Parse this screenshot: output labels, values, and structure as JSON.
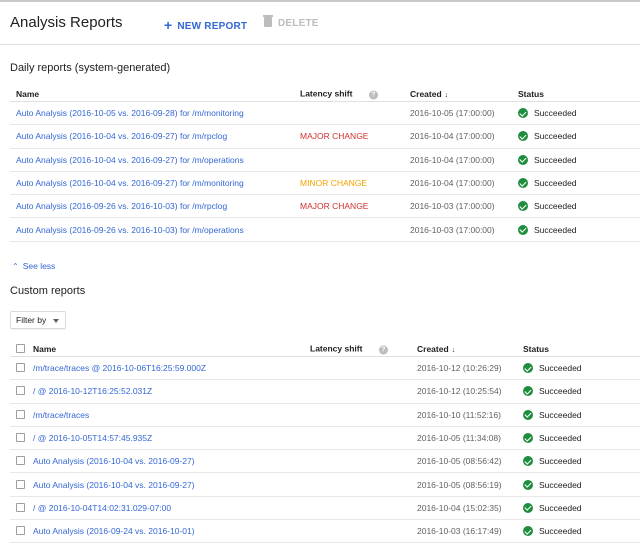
{
  "header": {
    "title": "Analysis Reports",
    "new_report_label": "NEW REPORT",
    "delete_label": "DELETE"
  },
  "daily": {
    "section_title": "Daily reports (system-generated)",
    "columns": {
      "name": "Name",
      "latency": "Latency shift",
      "created": "Created",
      "status": "Status"
    },
    "rows": [
      {
        "name": "Auto Analysis (2016-10-05 vs. 2016-09-28) for /m/monitoring",
        "shift": "",
        "shift_level": "",
        "created": "2016-10-05 (17:00:00)",
        "status": "Succeeded"
      },
      {
        "name": "Auto Analysis (2016-10-04 vs. 2016-09-27) for /m/rpclog",
        "shift": "MAJOR CHANGE",
        "shift_level": "major",
        "created": "2016-10-04 (17:00:00)",
        "status": "Succeeded"
      },
      {
        "name": "Auto Analysis (2016-10-04 vs. 2016-09-27) for /m/operations",
        "shift": "",
        "shift_level": "",
        "created": "2016-10-04 (17:00:00)",
        "status": "Succeeded"
      },
      {
        "name": "Auto Analysis (2016-10-04 vs. 2016-09-27) for /m/monitoring",
        "shift": "MINOR CHANGE",
        "shift_level": "minor",
        "created": "2016-10-04 (17:00:00)",
        "status": "Succeeded"
      },
      {
        "name": "Auto Analysis (2016-09-26 vs. 2016-10-03) for /m/rpclog",
        "shift": "MAJOR CHANGE",
        "shift_level": "major",
        "created": "2016-10-03 (17:00:00)",
        "status": "Succeeded"
      },
      {
        "name": "Auto Analysis (2016-09-26 vs. 2016-10-03) for /m/operations",
        "shift": "",
        "shift_level": "",
        "created": "2016-10-03 (17:00:00)",
        "status": "Succeeded"
      }
    ],
    "see_less_label": "See less"
  },
  "custom": {
    "section_title": "Custom reports",
    "filter_label": "Filter by",
    "columns": {
      "name": "Name",
      "latency": "Latency shift",
      "created": "Created",
      "status": "Status"
    },
    "rows": [
      {
        "name": "/m/trace/traces @ 2016-10-06T16:25:59.000Z",
        "created": "2016-10-12 (10:26:29)",
        "status": "Succeeded"
      },
      {
        "name": "/ @ 2016-10-12T16:25:52.031Z",
        "created": "2016-10-12 (10:25:54)",
        "status": "Succeeded"
      },
      {
        "name": "/m/trace/traces",
        "created": "2016-10-10 (11:52:16)",
        "status": "Succeeded"
      },
      {
        "name": "/ @ 2016-10-05T14:57:45.935Z",
        "created": "2016-10-05 (11:34:08)",
        "status": "Succeeded"
      },
      {
        "name": "Auto Analysis (2016-10-04 vs. 2016-09-27)",
        "created": "2016-10-05 (08:56:42)",
        "status": "Succeeded"
      },
      {
        "name": "Auto Analysis (2016-10-04 vs. 2016-09-27)",
        "created": "2016-10-05 (08:56:19)",
        "status": "Succeeded"
      },
      {
        "name": "/ @ 2016-10-04T14:02:31.029-07:00",
        "created": "2016-10-04 (15:02:35)",
        "status": "Succeeded"
      },
      {
        "name": "Auto Analysis (2016-09-24 vs. 2016-10-01)",
        "created": "2016-10-03 (16:17:49)",
        "status": "Succeeded"
      }
    ]
  },
  "colors": {
    "accent": "#3367d6",
    "major": "#d32f2f",
    "minor": "#f4a300",
    "success": "#1e8e3e"
  }
}
